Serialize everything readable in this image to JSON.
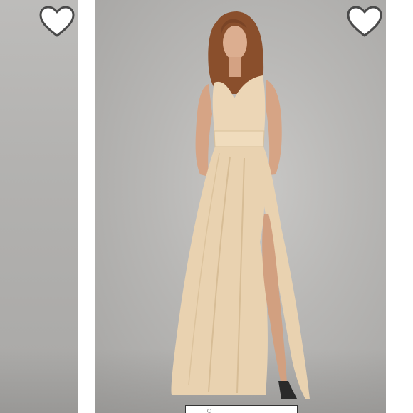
{
  "listing": {
    "images": [
      {
        "position": "previous",
        "background": "#b3b2b0"
      },
      {
        "position": "current",
        "background": "#b8b7b5",
        "dress_color": "#e9d2b0"
      }
    ],
    "like_icon": "heart-outline-icon"
  },
  "colors": {
    "heart_fill": "#ffffff",
    "heart_stroke": "#4a4a4a",
    "dress": "#e9d2b0",
    "sash": "#ead3b4",
    "hair": "#8a4f2c",
    "skin": "#d9a98a"
  }
}
